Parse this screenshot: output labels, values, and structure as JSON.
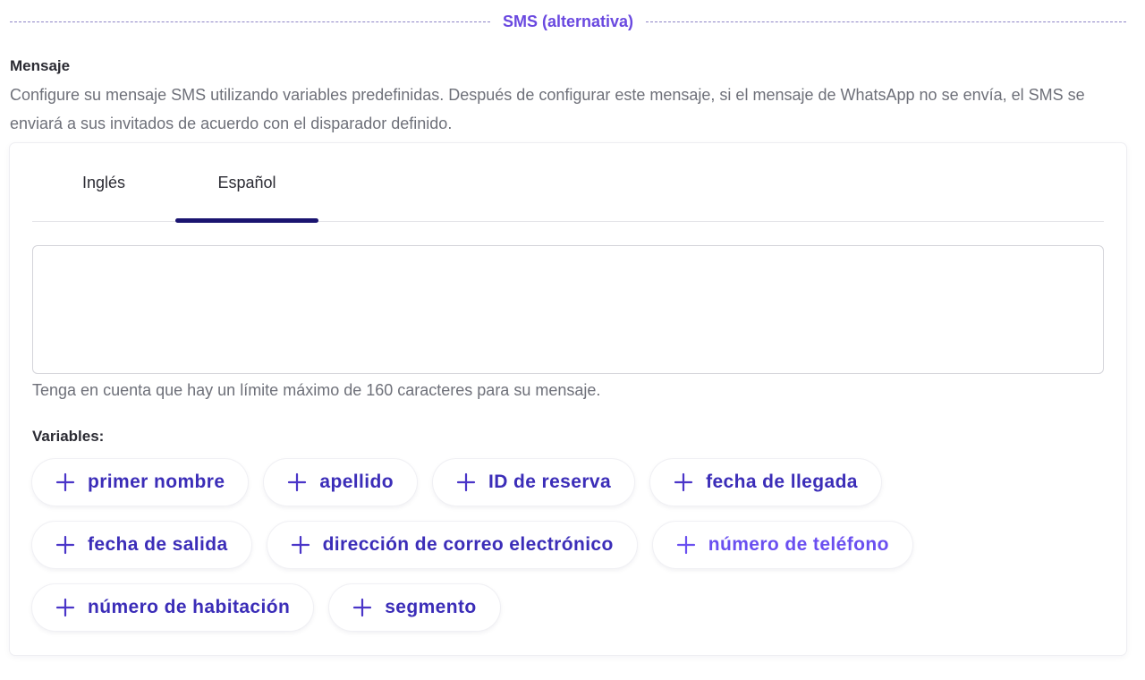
{
  "section": {
    "title": "SMS (alternativa)"
  },
  "message": {
    "label": "Mensaje",
    "description": "Configure su mensaje SMS utilizando variables predefinidas. Después de configurar este mensaje, si el mensaje de WhatsApp no se envía, el SMS se enviará a sus invitados de acuerdo con el disparador definido."
  },
  "tabs": [
    {
      "label": "Inglés",
      "active": false
    },
    {
      "label": "Español",
      "active": true
    }
  ],
  "editor": {
    "value": "",
    "placeholder": ""
  },
  "hint": "Tenga en cuenta que hay un límite máximo de 160 caracteres para su mensaje.",
  "variables": {
    "label": "Variables:",
    "icon": "plus-icon",
    "items": [
      "primer nombre",
      "apellido",
      "ID de reserva",
      "fecha de llegada",
      "fecha de salida",
      "dirección de correo electrónico",
      "número de teléfono",
      "número de habitación",
      "segmento"
    ]
  },
  "colors": {
    "accent": "#6a49e0",
    "chip_text": "#3b2db8",
    "tab_indicator": "#1a1470",
    "muted_text": "#6e7079"
  }
}
